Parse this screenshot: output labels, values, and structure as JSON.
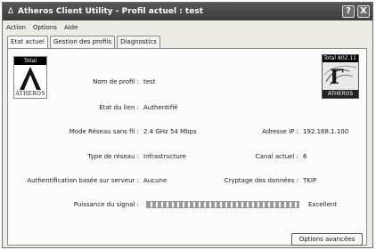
{
  "window": {
    "title": "Atheros Client Utility - Profil actuel : test",
    "help_button": "?",
    "close_button": "X"
  },
  "menu": [
    "Action",
    "Options",
    "Aide"
  ],
  "tabs": [
    {
      "label": "Etat actuel",
      "active": true
    },
    {
      "label": "Gestion des profils",
      "active": false
    },
    {
      "label": "Diagnostics",
      "active": false
    }
  ],
  "logos": {
    "left": {
      "badge": "Total 802.11",
      "name": "ATHEROS"
    },
    "right": {
      "badge": "Total 802.11",
      "name": "ATHEROS"
    }
  },
  "status": {
    "profile_label": "Nom de profil :",
    "profile_value": "test",
    "link_label": "État du lien :",
    "link_value": "Authentifié",
    "mode_label": "Mode Réseau sans fil :",
    "mode_value": "2.4 GHz 54 Mbps",
    "ip_label": "Adresse IP :",
    "ip_value": "192.168.1.100",
    "network_type_label": "Type de réseau :",
    "network_type_value": "Infrastructure",
    "channel_label": "Canal actuel :",
    "channel_value": "6",
    "auth_label": "Authentification basée sur serveur :",
    "auth_value": "Aucune",
    "encryption_label": "Cryptage des données :",
    "encryption_value": "TKIP",
    "signal_label": "Puissance du signal :",
    "signal_value": "Excellent",
    "signal_level_percent": 100
  },
  "buttons": {
    "advanced": "Options avancées"
  }
}
